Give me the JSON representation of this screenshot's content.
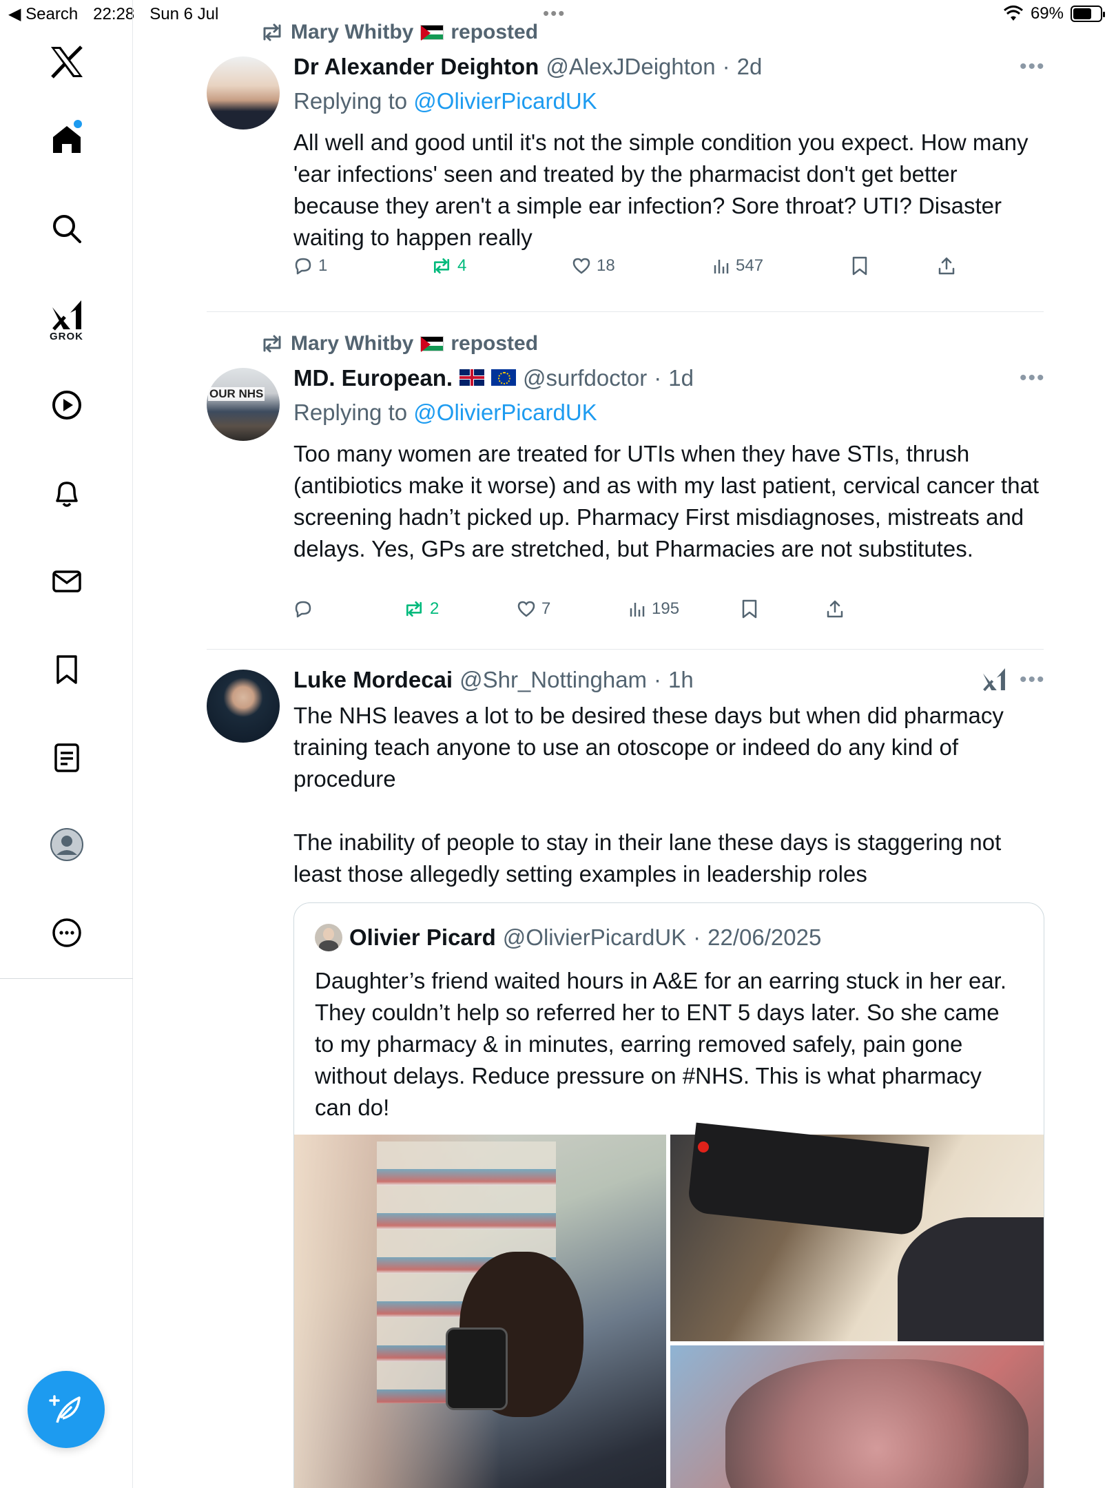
{
  "status_bar": {
    "back_label": "◀ Search",
    "time": "22:28",
    "date": "Sun 6 Jul",
    "battery": "69%",
    "battery_level": 0.69
  },
  "sidebar": {
    "grok_label": "GROK"
  },
  "tweets": [
    {
      "repost_by": "Mary Whitby",
      "repost_suffix": "reposted",
      "name": "Dr Alexander Deighton",
      "handle": "@AlexJDeighton",
      "time": "2d",
      "replying_prefix": "Replying to",
      "replying_to": "@OlivierPicardUK",
      "text": "All well and good until it's not the simple condition you expect. How many 'ear infections' seen and treated by the pharmacist don't get better because they aren't a simple ear infection? Sore throat? UTI? Disaster waiting to happen really",
      "replies": "1",
      "reposts": "4",
      "likes": "18",
      "views": "547"
    },
    {
      "repost_by": "Mary Whitby",
      "repost_suffix": "reposted",
      "name": "MD. European.",
      "handle": "@surfdoctor",
      "time": "1d",
      "avatar_text": "OUR NHS",
      "replying_prefix": "Replying to",
      "replying_to": "@OlivierPicardUK",
      "text": "Too many women are treated for UTIs when they have STIs, thrush (antibiotics make it worse) and as with my last patient, cervical cancer that screening hadn’t picked up. Pharmacy First misdiagnoses, mistreats and delays. Yes, GPs are stretched, but Pharmacies are not substitutes.",
      "replies": "",
      "reposts": "2",
      "likes": "7",
      "views": "195"
    },
    {
      "name": "Luke Mordecai",
      "handle": "@Shr_Nottingham",
      "time": "1h",
      "text": "The NHS leaves a lot to be desired these days but when did pharmacy training teach anyone to use an otoscope or indeed do any kind of procedure\n\nThe inability of people to stay in their lane these days is staggering not least those allegedly setting examples in leadership roles",
      "quote": {
        "name": "Olivier Picard",
        "handle": "@OlivierPicardUK",
        "date": "22/06/2025",
        "text": "Daughter’s friend waited hours in A&E for an earring stuck in her ear. They couldn’t help so referred her to ENT 5 days later. So she came to my pharmacy & in minutes, earring removed safely, pain gone without delays. Reduce pressure on #NHS. This is what pharmacy can do!"
      }
    }
  ],
  "separator": "·",
  "colors": {
    "accent": "#1d9bf0",
    "repost_green": "#00ba7c",
    "muted": "#536471"
  }
}
